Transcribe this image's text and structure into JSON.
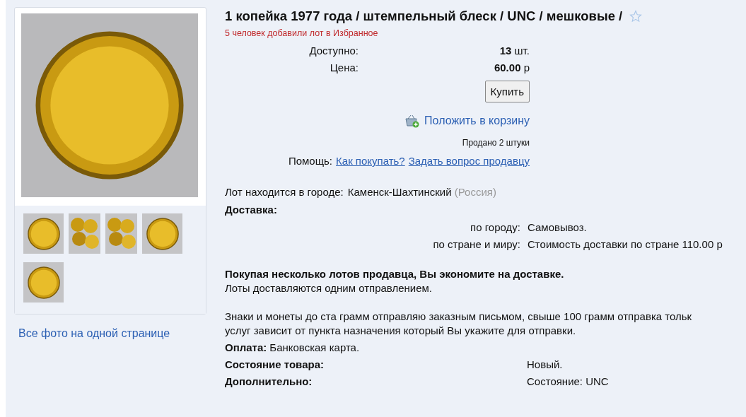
{
  "gallery": {
    "thumbnails": [
      {
        "kind": "coin"
      },
      {
        "kind": "pile"
      },
      {
        "kind": "pile"
      },
      {
        "kind": "coin"
      },
      {
        "kind": "coin"
      }
    ],
    "all_photos_link": "Все фото на одной странице"
  },
  "lot": {
    "title": "1 копейка 1977 года / штемпельный блеск / UNC / мешковые /",
    "favorites_note": "5 человек добавили лот в Избранное",
    "purchase": [
      {
        "label": "Доступно:",
        "value": "13",
        "unit": "шт."
      },
      {
        "label": "Цена:",
        "value": "60.00",
        "unit": "р"
      }
    ],
    "buy_button": "Купить",
    "cart_link": "Положить в корзину",
    "sold": "Продано 2 штуки",
    "help": {
      "label": "Помощь:",
      "links": [
        "Как покупать?",
        "Задать вопрос продавцу"
      ]
    },
    "location": {
      "label": "Лот находится в городе:",
      "city": "Каменск-Шахтинский",
      "country": "(Россия)"
    },
    "delivery": {
      "heading": "Доставка:",
      "rows": [
        {
          "label": "по городу:",
          "value": "Самовывоз."
        },
        {
          "label": "по стране и миру:",
          "value": "Стоимость доставки по стране 110.00 р"
        }
      ]
    },
    "savings": {
      "heading": "Покупая несколько лотов продавца, Вы экономите на доставке.",
      "text": "Лоты доставляются одним отправлением."
    },
    "shipping_note": [
      "Знаки и монеты до ста грамм отправляю заказным письмом, свыше 100 грамм отправка тольк",
      "услуг зависит от пункта назначения который Вы укажите для отправки."
    ],
    "payment": {
      "label": "Оплата:",
      "value": "Банковская карта."
    },
    "details": [
      {
        "label": "Состояние товара:",
        "value": "Новый."
      },
      {
        "label": "Дополнительно:",
        "value": "Состояние: UNC"
      }
    ]
  }
}
